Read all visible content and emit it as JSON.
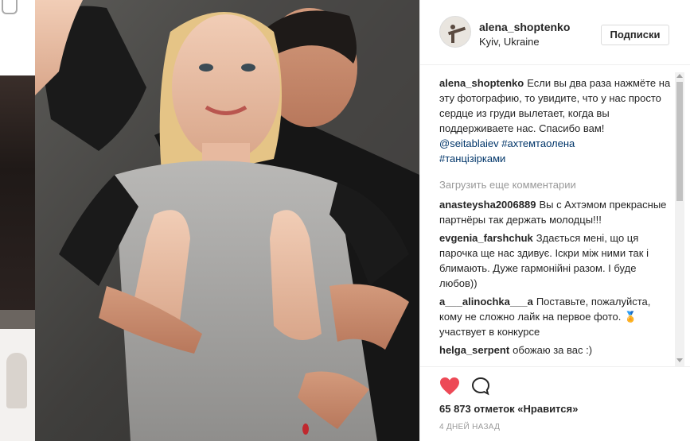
{
  "post": {
    "username": "alena_shoptenko",
    "location": "Kyiv, Ukraine",
    "follow_label": "Подписки"
  },
  "caption": {
    "author": "alena_shoptenko",
    "text": "Если вы два раза нажмёте на эту фотографию, то увидите, что у нас просто сердце из груди вылетает, когда вы поддерживаете нас. Спасибо вам!",
    "mention": "@seitablaiev",
    "tag1": "#ахтемтаолена",
    "tag2": "#танцізірками"
  },
  "load_more_label": "Загрузить еще комментарии",
  "comments": [
    {
      "author": "anasteysha2006889",
      "text": "Вы с Ахтэмом прекрасные партнёры так держать молодцы!!!"
    },
    {
      "author": "evgenia_farshchuk",
      "text": "Здається мені, що ця парочка ще нас здивує. Іскри між ними так і блимають. Дуже гармонійні разом. І буде любов))"
    },
    {
      "author": "a___alinochka___a",
      "text": "Поставьте, пожалуйста, кому не сложно лайк на первое фото. 🏅 участвует в конкурсе"
    },
    {
      "author": "helga_serpent",
      "text": "обожаю за вас :)"
    }
  ],
  "likes_text": "65 873 отметок «Нравится»",
  "time_text": "4 ДНЕЙ НАЗАД",
  "colors": {
    "heart": "#ed4956",
    "link": "#003569",
    "muted": "#999999",
    "text": "#262626"
  },
  "icons": {
    "like": "heart-icon",
    "comment": "comment-icon"
  }
}
